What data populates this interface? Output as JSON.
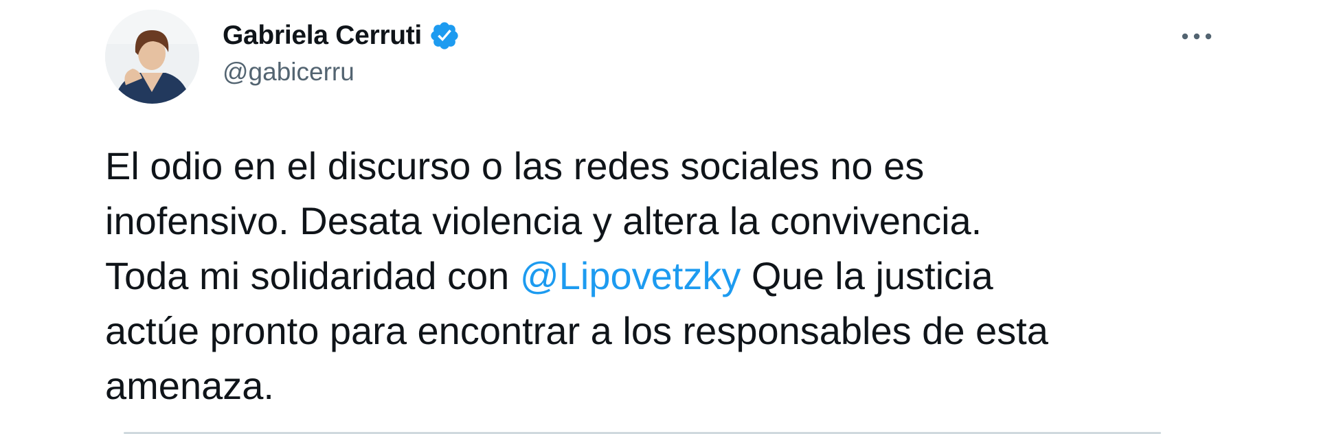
{
  "author": {
    "display_name": "Gabriela Cerruti",
    "handle": "@gabicerru",
    "verified_icon": "verified-badge-icon",
    "avatar_icon": "profile-photo"
  },
  "menu": {
    "icon": "more-options-icon"
  },
  "tweet": {
    "line1": "El odio en el discurso o las redes sociales no es",
    "line2": "inofensivo. Desata violencia y altera la convivencia.",
    "line3_before": "Toda mi solidaridad con ",
    "mention": "@Lipovetzky",
    "line3_after": " Que la justicia",
    "line4": "actúe pronto para encontrar a los responsables de esta",
    "line5": "amenaza."
  },
  "colors": {
    "text": "#0f1419",
    "secondary": "#536471",
    "accent": "#1d9bf0",
    "divider": "#cfd9de"
  }
}
